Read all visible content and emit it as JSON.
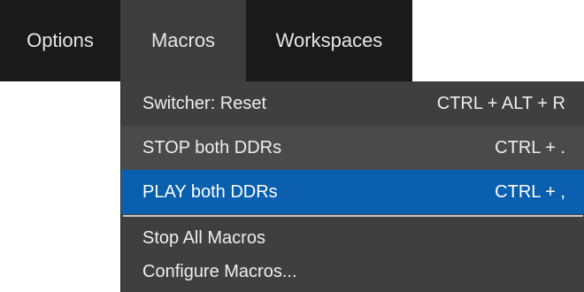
{
  "menubar": {
    "items": [
      {
        "label": "Options"
      },
      {
        "label": "Macros"
      },
      {
        "label": "Workspaces"
      }
    ]
  },
  "dropdown": {
    "items": [
      {
        "label": "Switcher: Reset",
        "shortcut": "CTRL + ALT + R"
      },
      {
        "label": "STOP both DDRs",
        "shortcut": "CTRL + ."
      },
      {
        "label": "PLAY both DDRs",
        "shortcut": "CTRL + ,"
      },
      {
        "label": "Stop All Macros"
      },
      {
        "label": "Configure Macros..."
      }
    ]
  },
  "colors": {
    "menubar_bg": "#1a1a1a",
    "active_menu_bg": "#3d3d3d",
    "dropdown_bg": "#3f3f3f",
    "hover_bg": "#4a4a4a",
    "selected_bg": "#0a5fae"
  }
}
